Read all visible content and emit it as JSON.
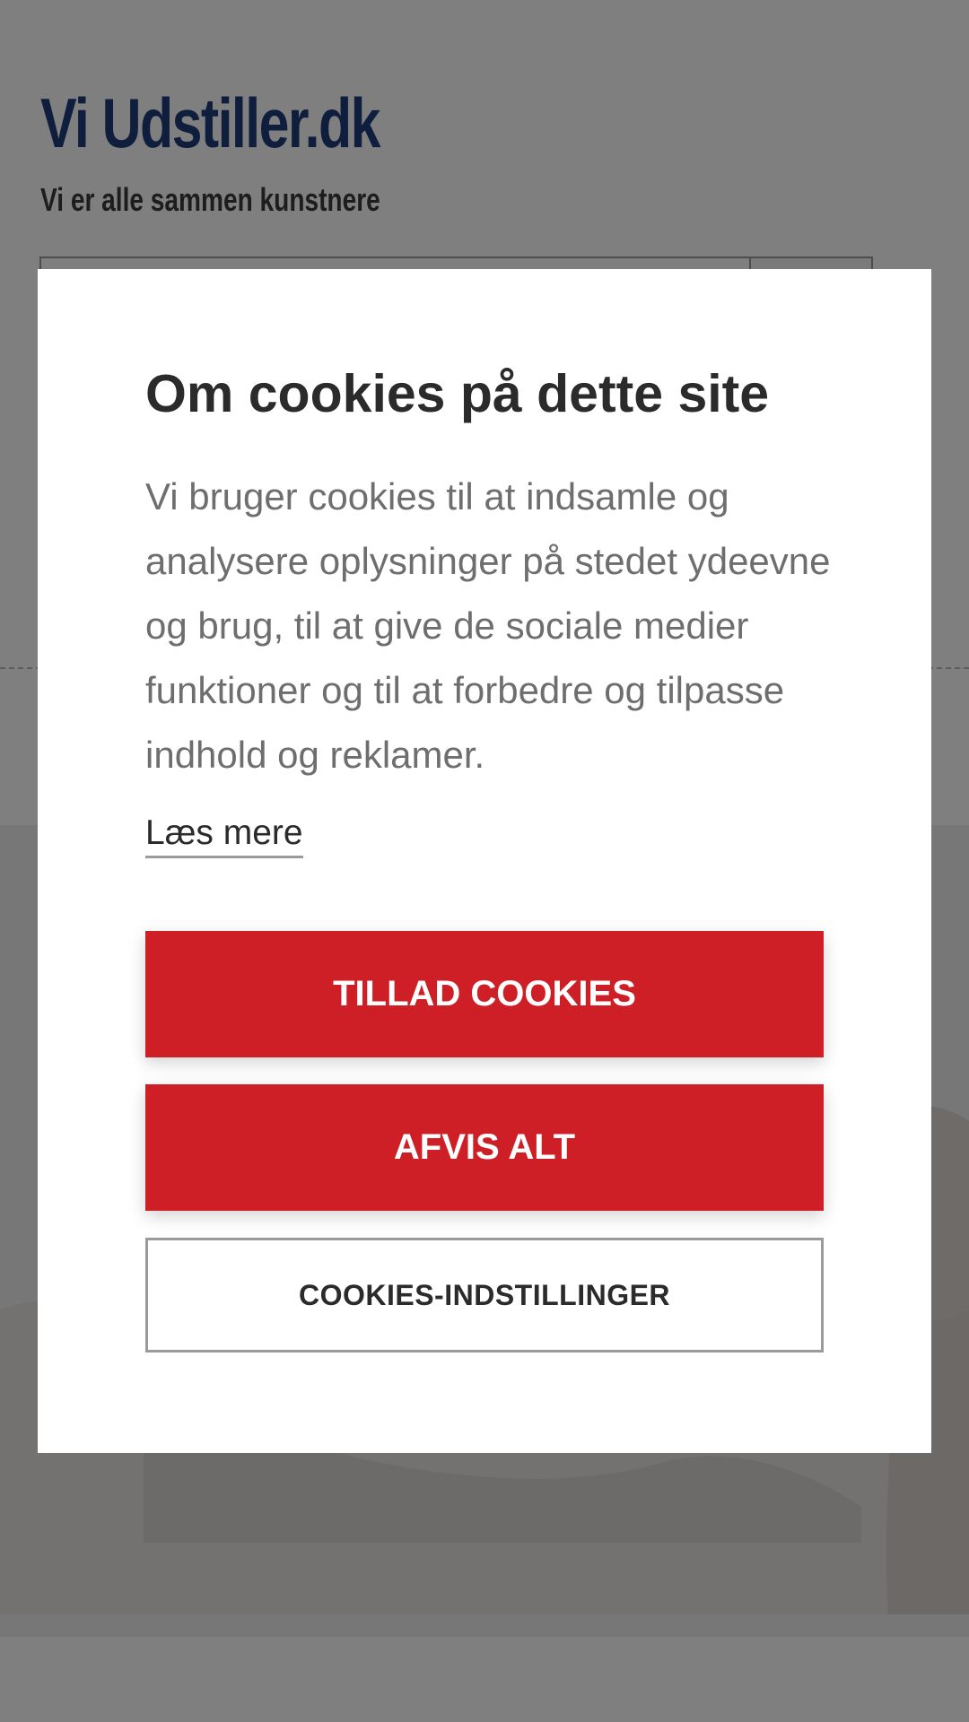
{
  "site": {
    "title": "Vi Udstiller.dk",
    "tagline": "Vi er alle sammen kunstnere",
    "colors": {
      "title": "#1f3d7a"
    }
  },
  "cookie_dialog": {
    "title": "Om cookies på dette site",
    "text": "Vi bruger cookies til at indsamle og analysere oplysninger på stedet ydeevne og brug, til at give de sociale medier funktioner og til at forbedre og tilpasse indhold og reklamer.",
    "read_more": "Læs mere",
    "allow_button": "TILLAD COOKIES",
    "reject_button": "AFVIS ALT",
    "settings_button": "COOKIES-INDSTILLINGER",
    "colors": {
      "primary_button": "#cf1f26",
      "overlay": "rgba(0,0,0,0.5)"
    }
  }
}
